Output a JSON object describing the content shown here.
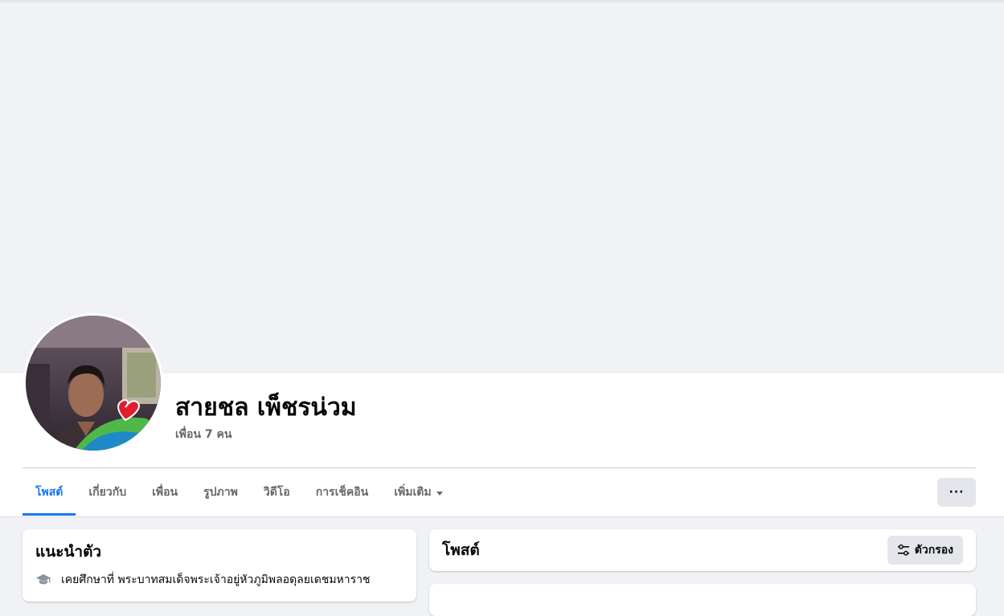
{
  "profile": {
    "name": "สายชล เพ็ชรน่วม",
    "friends_count": "เพื่อน 7 คน"
  },
  "tabs": [
    {
      "label": "โพสต์",
      "active": true
    },
    {
      "label": "เกี่ยวกับ",
      "active": false
    },
    {
      "label": "เพื่อน",
      "active": false
    },
    {
      "label": "รูปภาพ",
      "active": false
    },
    {
      "label": "วิดีโอ",
      "active": false
    },
    {
      "label": "การเช็คอิน",
      "active": false
    },
    {
      "label": "เพิ่มเติม",
      "active": false
    }
  ],
  "more_button": {
    "label": "···",
    "icon": "more-dots-icon"
  },
  "intro": {
    "title": "แนะนำตัว",
    "education": "เคยศึกษาที่ พระบาทสมเด็จพระเจ้าอยู่หัวภูมิพลอดุลยเดชมหาราช",
    "education_icon": "graduation-cap-icon"
  },
  "posts": {
    "title": "โพสต์",
    "filter_label": "ตัวกรอง",
    "filter_icon": "filter-sliders-icon"
  },
  "colors": {
    "accent": "#1877f2",
    "background": "#f0f2f5",
    "secondary_text": "#65676b"
  }
}
